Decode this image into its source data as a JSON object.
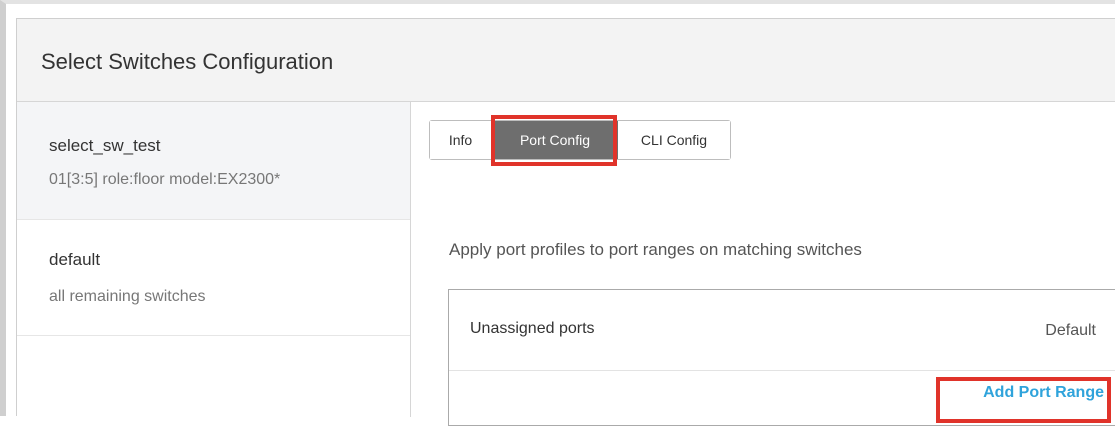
{
  "panel": {
    "title": "Select Switches Configuration"
  },
  "sidebar": {
    "items": [
      {
        "name": "select_sw_test",
        "subtitle": "01[3:5] role:floor model:EX2300*",
        "selected": true
      },
      {
        "name": "default",
        "subtitle": "all remaining switches",
        "selected": false
      }
    ]
  },
  "tabs": [
    {
      "label": "Info"
    },
    {
      "label": "Port Config",
      "active": true
    },
    {
      "label": "CLI Config"
    }
  ],
  "port_config": {
    "description": "Apply port profiles to port ranges on matching switches",
    "unassigned_label": "Unassigned ports",
    "unassigned_value": "Default",
    "add_range_label": "Add Port Range"
  },
  "colors": {
    "accent_link": "#2fa3db",
    "active_tab": "#6e6e6e",
    "highlight": "#e0332a"
  }
}
